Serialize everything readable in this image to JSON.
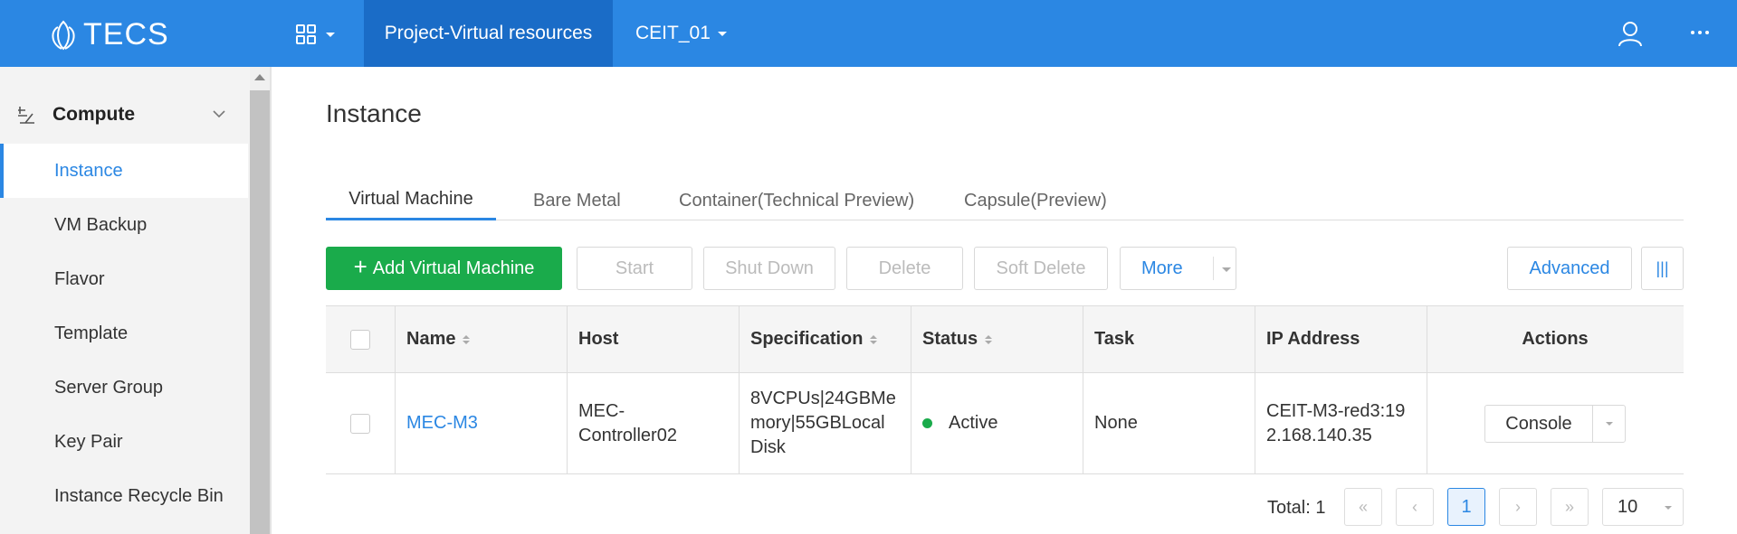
{
  "header": {
    "brand": "TECS",
    "active_nav": "Project-Virtual resources",
    "project": "CEIT_01"
  },
  "sidebar": {
    "section": "Compute",
    "items": [
      {
        "label": "Instance"
      },
      {
        "label": "VM Backup"
      },
      {
        "label": "Flavor"
      },
      {
        "label": "Template"
      },
      {
        "label": "Server Group"
      },
      {
        "label": "Key Pair"
      },
      {
        "label": "Instance Recycle Bin"
      }
    ]
  },
  "main": {
    "title": "Instance",
    "tabs": [
      "Virtual Machine",
      "Bare Metal",
      "Container(Technical Preview)",
      "Capsule(Preview)"
    ],
    "toolbar": {
      "add": "Add Virtual Machine",
      "start": "Start",
      "shutdown": "Shut Down",
      "delete": "Delete",
      "soft_delete": "Soft Delete",
      "more": "More",
      "advanced": "Advanced",
      "columns": "|||"
    },
    "table": {
      "columns": [
        "Name",
        "Host",
        "Specification",
        "Status",
        "Task",
        "IP Address",
        "Actions"
      ],
      "rows": [
        {
          "name": "MEC-M3",
          "host": "MEC-Controller02",
          "spec": "8VCPUs|24GBMemory|55GBLocal Disk",
          "status": "Active",
          "task": "None",
          "ip": "CEIT-M3-red3:192.168.140.35",
          "action": "Console"
        }
      ]
    },
    "pagination": {
      "total": "Total: 1",
      "current_page": "1",
      "page_size": "10",
      "first": "«",
      "prev": "‹",
      "next": "›",
      "last": "»"
    }
  },
  "colors": {
    "header": "#2b87e3",
    "nav_active": "#1a6cc7",
    "primary_button": "#1aab4b",
    "status_active": "#1aab4b"
  }
}
